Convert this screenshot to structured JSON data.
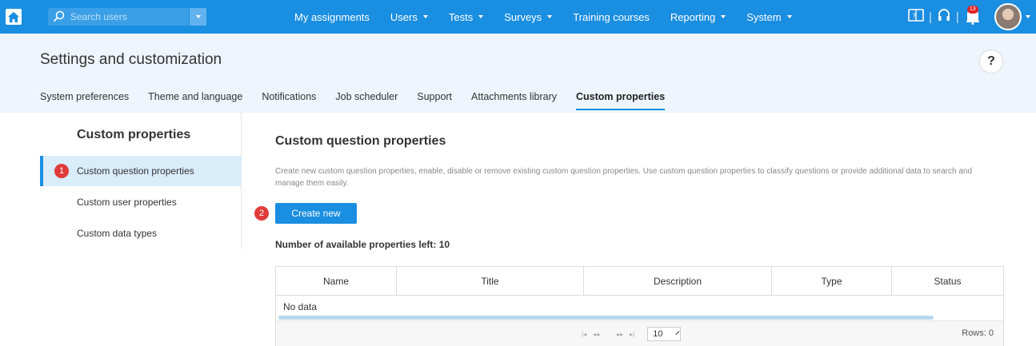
{
  "topbar": {
    "search_placeholder": "Search users",
    "nav": [
      {
        "label": "My assignments",
        "dropdown": false
      },
      {
        "label": "Users",
        "dropdown": true
      },
      {
        "label": "Tests",
        "dropdown": true
      },
      {
        "label": "Surveys",
        "dropdown": true
      },
      {
        "label": "Training courses",
        "dropdown": false
      },
      {
        "label": "Reporting",
        "dropdown": true
      },
      {
        "label": "System",
        "dropdown": true
      }
    ],
    "notification_count": "13"
  },
  "header": {
    "title": "Settings and customization",
    "help_label": "?",
    "tabs": [
      {
        "label": "System preferences",
        "active": false
      },
      {
        "label": "Theme and language",
        "active": false
      },
      {
        "label": "Notifications",
        "active": false
      },
      {
        "label": "Job scheduler",
        "active": false
      },
      {
        "label": "Support",
        "active": false
      },
      {
        "label": "Attachments library",
        "active": false
      },
      {
        "label": "Custom properties",
        "active": true
      }
    ]
  },
  "sidebar": {
    "title": "Custom properties",
    "items": [
      {
        "label": "Custom question properties",
        "active": true
      },
      {
        "label": "Custom user properties",
        "active": false
      },
      {
        "label": "Custom data types",
        "active": false
      }
    ]
  },
  "annotations": {
    "step1": "1",
    "step2": "2"
  },
  "main": {
    "title": "Custom question properties",
    "description": "Create new custom question properties, enable, disable or remove existing custom question properties. Use custom question properties to classify questions or provide additional data to search and manage them easily.",
    "create_label": "Create new",
    "available": "Number of available properties left: 10"
  },
  "table": {
    "columns": [
      "Name",
      "Title",
      "Description",
      "Type",
      "Status"
    ],
    "empty_text": "No data",
    "pager": {
      "first": "|◂",
      "prev": "◂◂",
      "next": "▸▸",
      "last": "▸|",
      "page_size": "10"
    },
    "rows_label": "Rows: 0"
  },
  "colors": {
    "primary": "#1a8ee0",
    "header_bg": "#eef5fc",
    "active_item_bg": "#d9ecfa",
    "annotation_red": "#e03b3b"
  }
}
